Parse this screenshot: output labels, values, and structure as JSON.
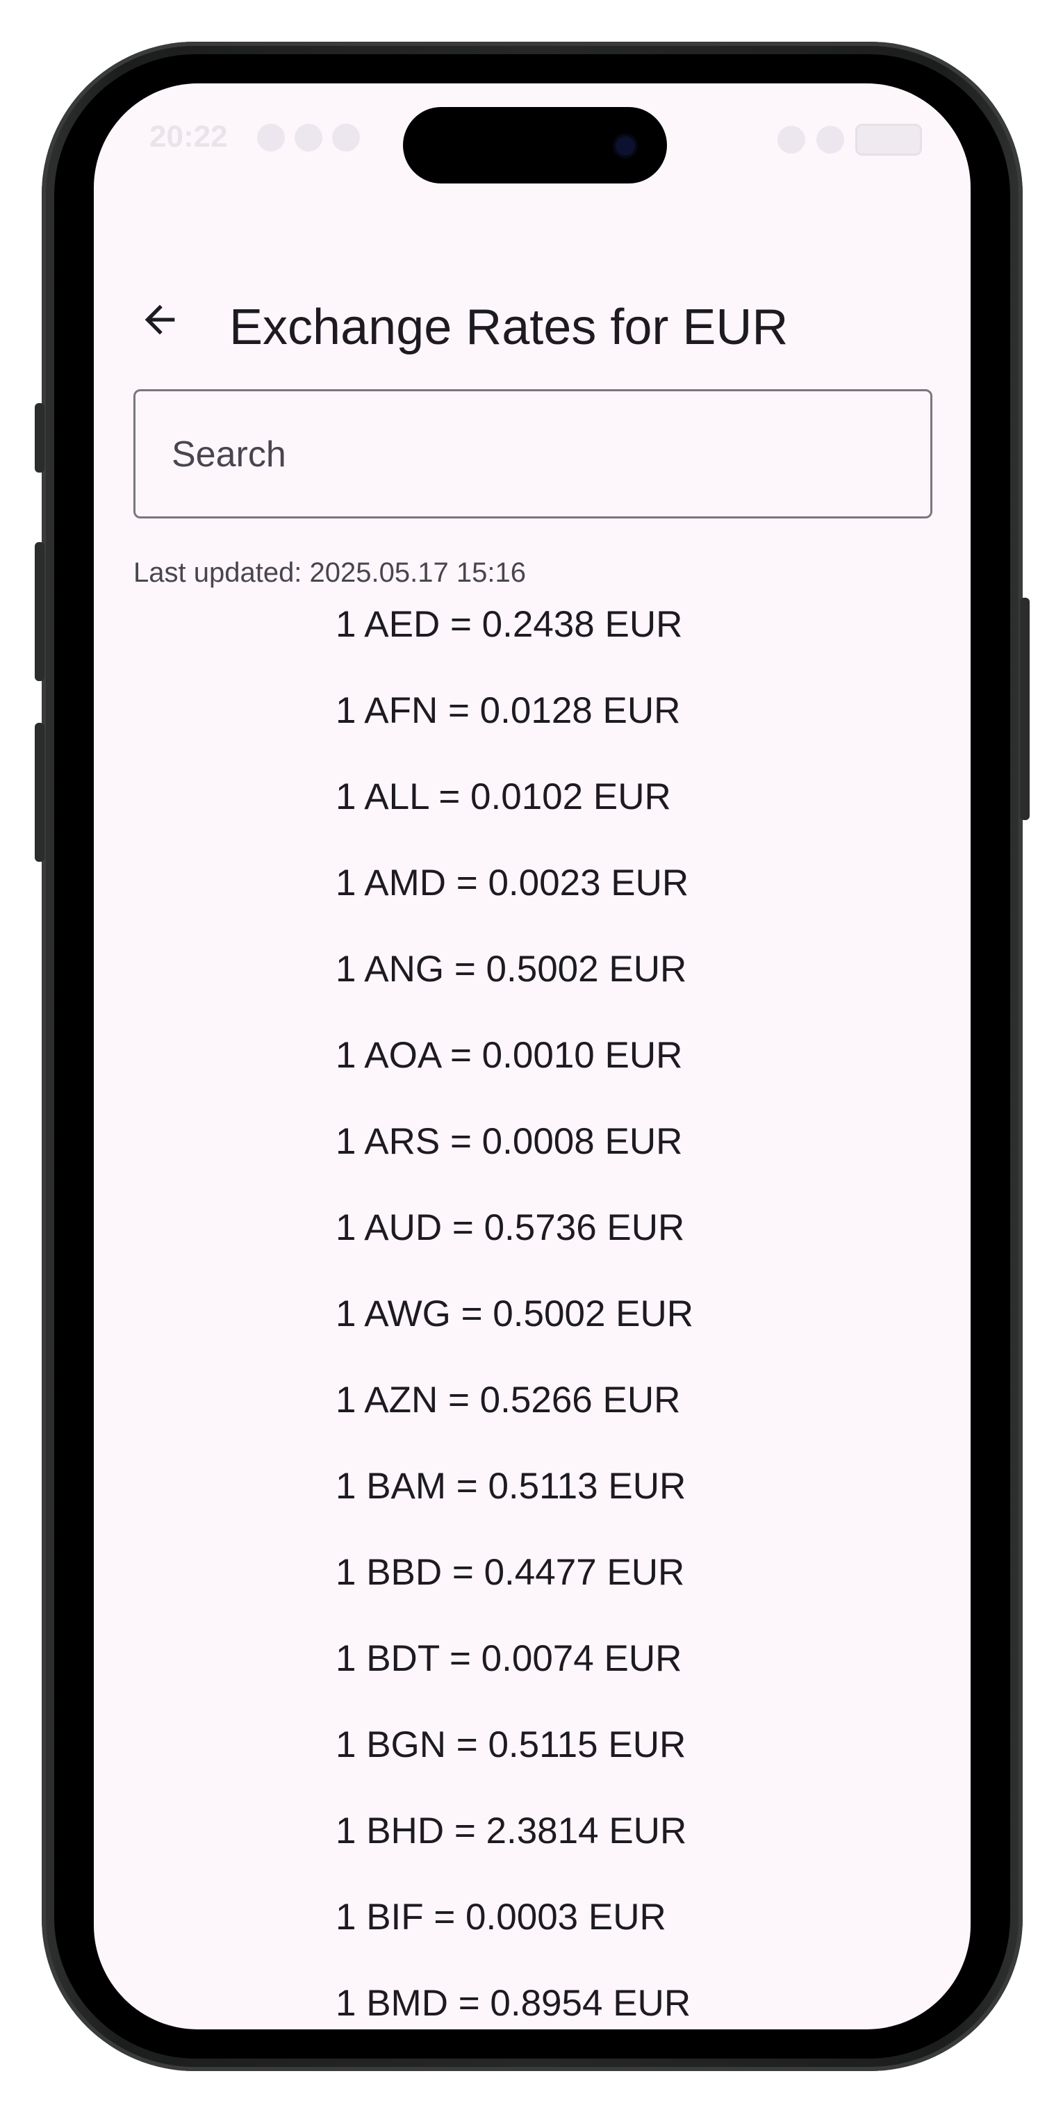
{
  "status_bar": {
    "time": "20:22"
  },
  "app_bar": {
    "back_icon": "arrow-left-icon",
    "title": "Exchange Rates for EUR"
  },
  "search": {
    "placeholder": "Search",
    "value": ""
  },
  "last_updated": "Last updated: 2025.05.17 15:16",
  "rates": [
    "1 AED = 0.2438 EUR",
    "1 AFN = 0.0128 EUR",
    "1 ALL = 0.0102 EUR",
    "1 AMD = 0.0023 EUR",
    "1 ANG = 0.5002 EUR",
    "1 AOA = 0.0010 EUR",
    "1 ARS = 0.0008 EUR",
    "1 AUD = 0.5736 EUR",
    "1 AWG = 0.5002 EUR",
    "1 AZN = 0.5266 EUR",
    "1 BAM = 0.5113 EUR",
    "1 BBD = 0.4477 EUR",
    "1 BDT = 0.0074 EUR",
    "1 BGN = 0.5115 EUR",
    "1 BHD = 2.3814 EUR",
    "1 BIF = 0.0003 EUR",
    "1 BMD = 0.8954 EUR"
  ],
  "colors": {
    "screen_background": "#fdf7fc",
    "text_primary": "#1e1a22",
    "text_secondary": "#49454f",
    "outline": "#7b757f",
    "phone_frame": "#262827"
  }
}
